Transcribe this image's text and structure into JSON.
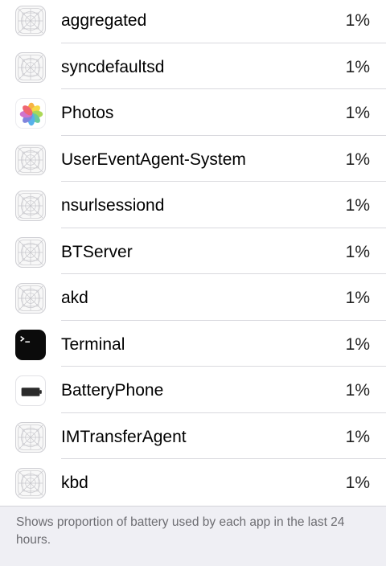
{
  "battery_usage": {
    "apps": [
      {
        "name": "aggregated",
        "percent": "1%",
        "icon": "app-placeholder-icon"
      },
      {
        "name": "syncdefaultsd",
        "percent": "1%",
        "icon": "app-placeholder-icon"
      },
      {
        "name": "Photos",
        "percent": "1%",
        "icon": "photos-icon"
      },
      {
        "name": "UserEventAgent-System",
        "percent": "1%",
        "icon": "app-placeholder-icon"
      },
      {
        "name": "nsurlsessiond",
        "percent": "1%",
        "icon": "app-placeholder-icon"
      },
      {
        "name": "BTServer",
        "percent": "1%",
        "icon": "app-placeholder-icon"
      },
      {
        "name": "akd",
        "percent": "1%",
        "icon": "app-placeholder-icon"
      },
      {
        "name": "Terminal",
        "percent": "1%",
        "icon": "terminal-icon"
      },
      {
        "name": "BatteryPhone",
        "percent": "1%",
        "icon": "battery-icon"
      },
      {
        "name": "IMTransferAgent",
        "percent": "1%",
        "icon": "app-placeholder-icon"
      },
      {
        "name": "kbd",
        "percent": "1%",
        "icon": "app-placeholder-icon"
      }
    ],
    "footer_note": "Shows proportion of battery used by each app in the last 24 hours."
  },
  "colors": {
    "list_background": "#ffffff",
    "group_background": "#efeff4",
    "separator": "#d9d9de",
    "footer_text": "#6d6d72"
  }
}
